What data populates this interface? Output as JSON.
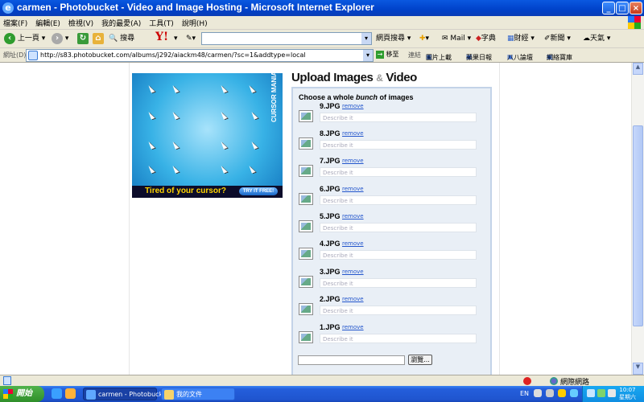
{
  "window": {
    "title": "carmen - Photobucket - Video and Image Hosting - Microsoft Internet Explorer",
    "minimize": "_",
    "maximize": "□",
    "close": "×"
  },
  "menu": [
    "檔案(F)",
    "編輯(E)",
    "檢視(V)",
    "我的最愛(A)",
    "工具(T)",
    "說明(H)"
  ],
  "toolbar": {
    "back": "上一頁",
    "search": "搜尋",
    "yahoo": "Y!",
    "web_search": "網頁搜尋",
    "mail": "Mail",
    "dictionary": "字典",
    "finance": "財經",
    "news": "新聞",
    "weather": "天氣"
  },
  "address": {
    "label": "網址(D)",
    "url": "http://s83.photobucket.com/albums/j292/aiackm48/carmen/?sc=1&addtype=local",
    "go": "移至",
    "links_label": "連結",
    "links": [
      "圖片上載",
      "蘋果日報",
      "八八論壇",
      "網絡寶庫"
    ]
  },
  "ad": {
    "vertical_text": "CURSOR MANIA",
    "tagline": "Tired of your cursor?",
    "button": "TRY IT FREE!"
  },
  "upload": {
    "title_a": "Upload Images",
    "title_amp": "&",
    "title_b": "Video",
    "heading_pre": "Choose a whole ",
    "heading_em": "bunch",
    "heading_post": " of images",
    "remove_label": "remove",
    "desc_placeholder": "Describe it",
    "files": [
      "9.JPG",
      "8.JPG",
      "7.JPG",
      "6.JPG",
      "5.JPG",
      "4.JPG",
      "3.JPG",
      "2.JPG",
      "1.JPG"
    ],
    "browse": "瀏覽..."
  },
  "status": {
    "zone": "網際網路"
  },
  "taskbar": {
    "start": "開始",
    "tasks": [
      "carmen - Photobucket ...",
      "我的文件"
    ],
    "language": "EN",
    "time": "10:07",
    "day": "星期六"
  }
}
